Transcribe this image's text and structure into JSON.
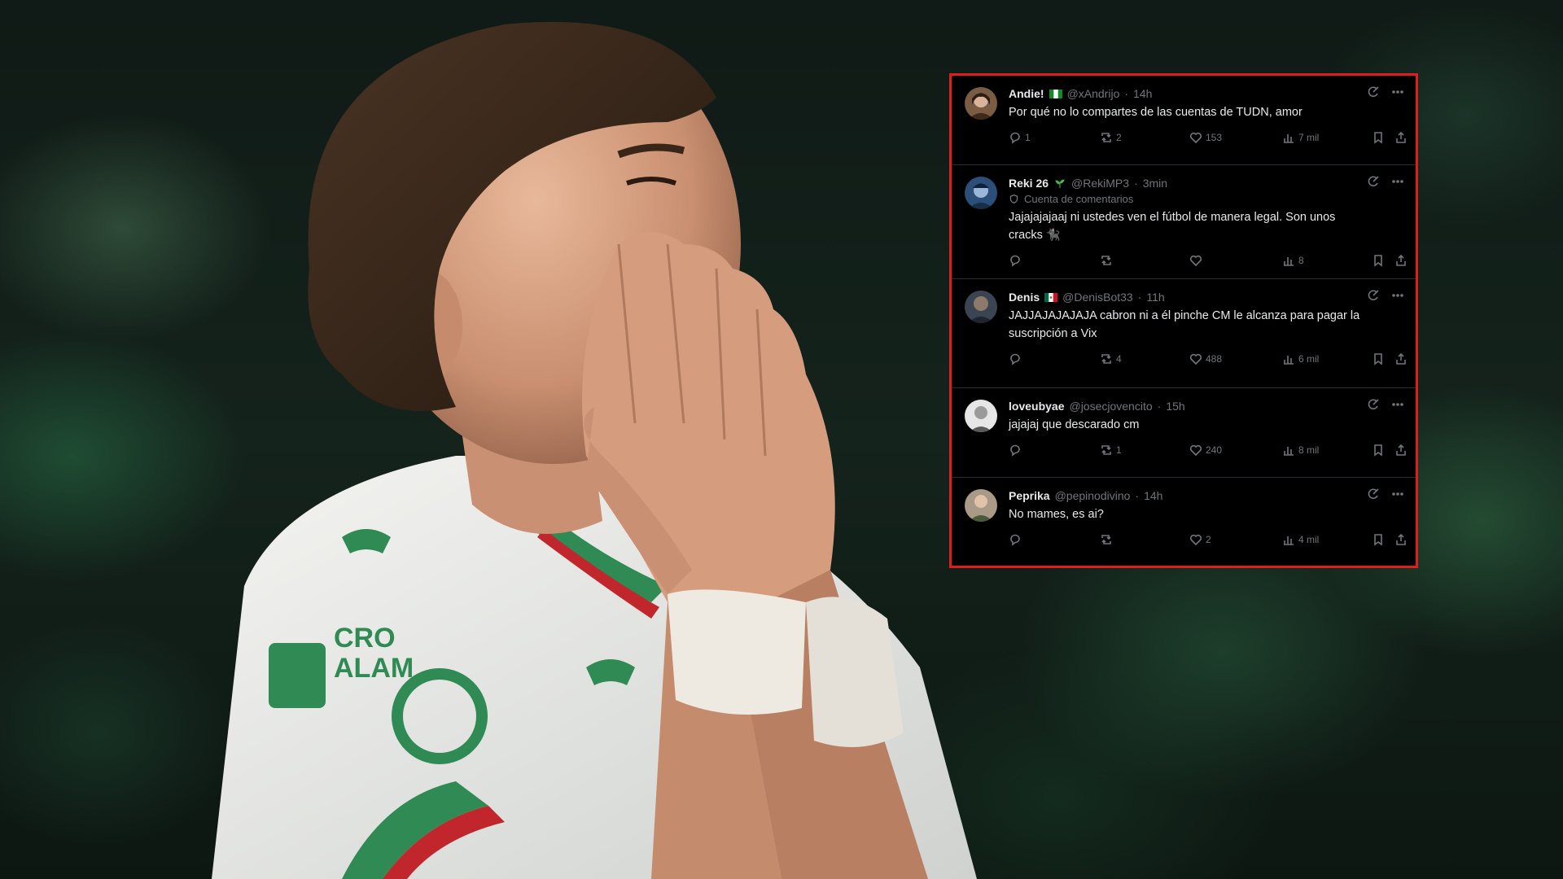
{
  "tweets": [
    {
      "name": "Andie!",
      "handle": "@xAndrijo",
      "time": "14h",
      "flag": "ng",
      "text": "Por qué no lo compartes de las cuentas de TUDN, amor",
      "replies": "1",
      "retweets": "2",
      "likes": "153",
      "views": "7 mil"
    },
    {
      "name": "Reki 26",
      "handle": "@RekiMP3",
      "time": "3min",
      "flag": "sprout",
      "subline": "Cuenta de comentarios",
      "text": "Jajajajajaaj ni ustedes ven el fútbol de manera legal. Son unos cracks 🐈‍⬛",
      "replies": "",
      "retweets": "",
      "likes": "",
      "views": "8"
    },
    {
      "name": "Denis",
      "handle": "@DenisBot33",
      "time": "11h",
      "flag": "mx",
      "text": "JAJJAJAJAJAJA cabron ni a él pinche CM le alcanza para pagar la suscripción a Vix",
      "replies": "",
      "retweets": "4",
      "likes": "488",
      "views": "6 mil"
    },
    {
      "name": "loveubyae",
      "handle": "@josecjovencito",
      "time": "15h",
      "flag": "",
      "text": "jajajaj que descarado cm",
      "replies": "",
      "retweets": "1",
      "likes": "240",
      "views": "8 mil"
    },
    {
      "name": "Peprika",
      "handle": "@pepinodivino",
      "time": "14h",
      "flag": "",
      "text": "No mames, es ai?",
      "replies": "",
      "retweets": "",
      "likes": "2",
      "views": "4 mil"
    }
  ],
  "icons": {
    "reply": "reply-icon",
    "retweet": "retweet-icon",
    "like": "heart-icon",
    "views": "views-icon",
    "bookmark": "bookmark-icon",
    "share": "share-icon",
    "grok": "grok-icon",
    "more": "more-icon"
  },
  "colors": {
    "highlight_border": "#e01d1d",
    "panel_bg": "#000000",
    "muted": "#71767b"
  }
}
